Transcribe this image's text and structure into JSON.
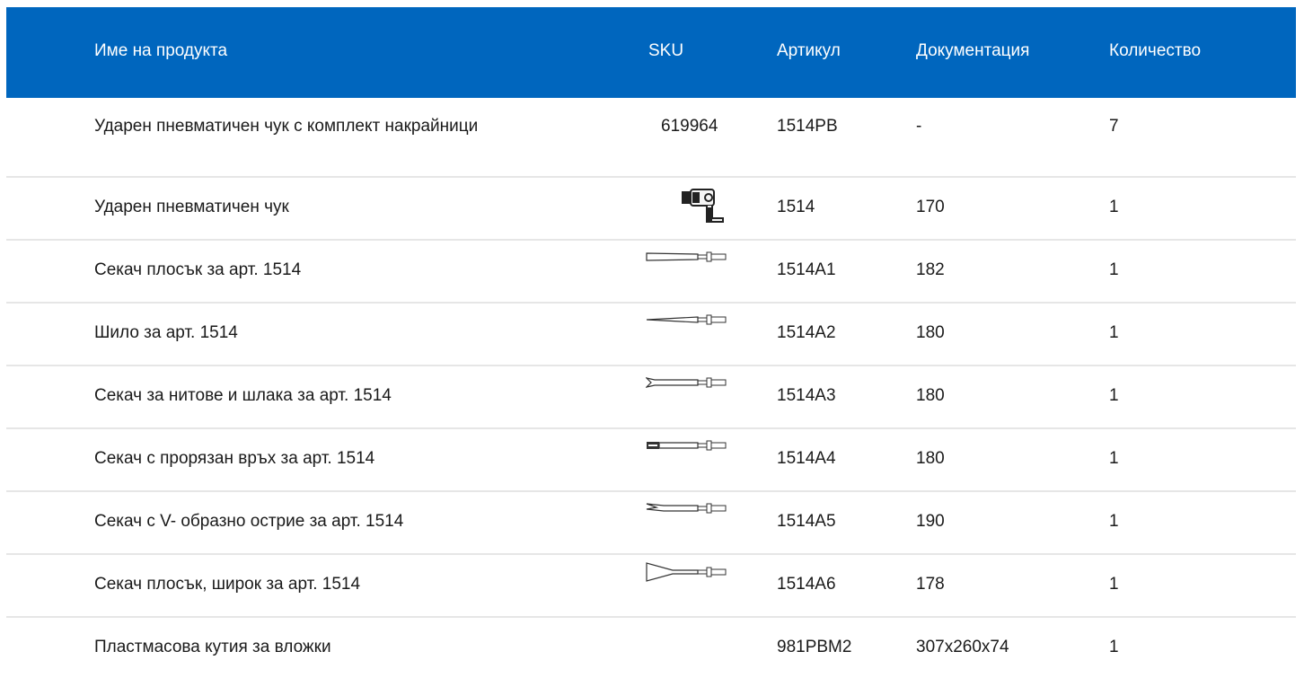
{
  "header": {
    "columns": [
      "Име на продукта",
      "SKU",
      "Артикул",
      "Документация",
      "Количество"
    ],
    "background": "#0066be"
  },
  "rows": [
    {
      "name": "Ударен пневматичен чук с комплект накрайници",
      "sku": "619964",
      "article": "1514PB",
      "doc": "-",
      "qty": "7",
      "icon": ""
    },
    {
      "name": "Ударен пневматичен чук",
      "sku": "",
      "article": "1514",
      "doc": "170",
      "qty": "1",
      "icon": "air-hammer-icon"
    },
    {
      "name": "Секач плосък за арт. 1514",
      "sku": "",
      "article": "1514A1",
      "doc": "182",
      "qty": "1",
      "icon": "flat-chisel-icon"
    },
    {
      "name": "Шило за арт. 1514",
      "sku": "",
      "article": "1514A2",
      "doc": "180",
      "qty": "1",
      "icon": "punch-icon"
    },
    {
      "name": "Секач за нитове и шлака за арт. 1514",
      "sku": "",
      "article": "1514A3",
      "doc": "180",
      "qty": "1",
      "icon": "rivet-chisel-icon"
    },
    {
      "name": "Секач с прорязан връх за арт. 1514",
      "sku": "",
      "article": "1514A4",
      "doc": "180",
      "qty": "1",
      "icon": "slotted-chisel-icon"
    },
    {
      "name": "Секач с V- образно острие за арт. 1514",
      "sku": "",
      "article": "1514A5",
      "doc": "190",
      "qty": "1",
      "icon": "v-chisel-icon"
    },
    {
      "name": "Секач плосък, широк за арт. 1514",
      "sku": "",
      "article": "1514A6",
      "doc": "178",
      "qty": "1",
      "icon": "wide-chisel-icon"
    },
    {
      "name": "Пластмасова кутия за вложки",
      "sku": "",
      "article": "981PBM2",
      "doc": "307x260x74",
      "qty": "1",
      "icon": ""
    }
  ]
}
